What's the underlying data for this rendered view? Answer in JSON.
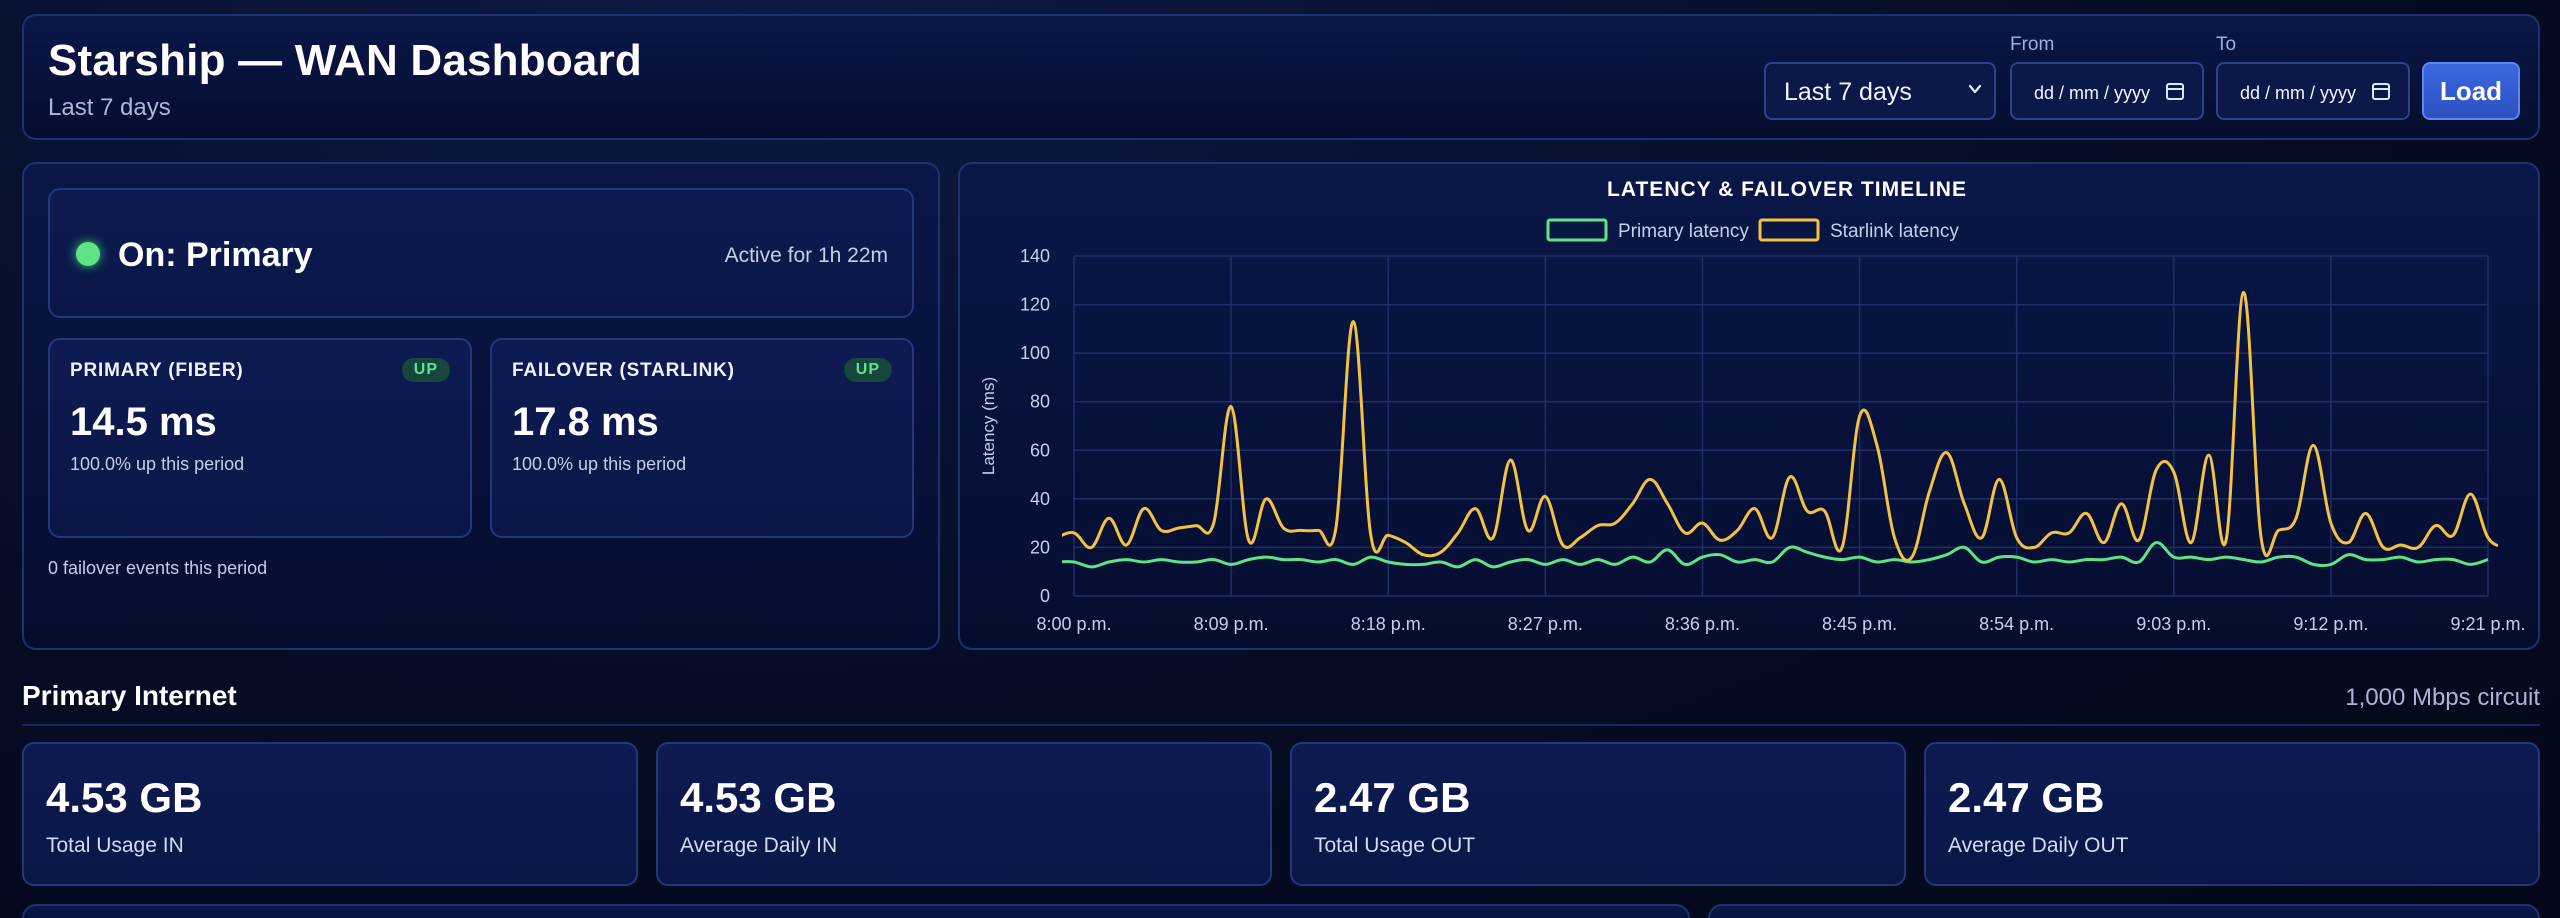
{
  "header": {
    "title": "Starship — WAN Dashboard",
    "subtitle": "Last 7 days",
    "range_selected": "Last 7 days",
    "from_label": "From",
    "to_label": "To",
    "from_value": "dd / mm / yyyy",
    "to_value": "dd / mm / yyyy",
    "load_label": "Load"
  },
  "status": {
    "state": "On: Primary",
    "active_for": "Active for 1h 22m",
    "color_ok": "#5ee487"
  },
  "links": {
    "primary": {
      "title": "PRIMARY (FIBER)",
      "badge": "UP",
      "latency": "14.5 ms",
      "uptime": "100.0% up this period"
    },
    "starlink": {
      "title": "FAILOVER (STARLINK)",
      "badge": "UP",
      "latency": "17.8 ms",
      "uptime": "100.0% up this period"
    }
  },
  "failover_events": "0 failover events this period",
  "primary_internet": {
    "title": "Primary Internet",
    "circuit": "1,000 Mbps circuit",
    "stats": [
      {
        "value": "4.53 GB",
        "label": "Total Usage IN"
      },
      {
        "value": "4.53 GB",
        "label": "Average Daily IN"
      },
      {
        "value": "2.47 GB",
        "label": "Total Usage OUT"
      },
      {
        "value": "2.47 GB",
        "label": "Average Daily OUT"
      }
    ]
  },
  "chart_data": {
    "type": "line",
    "title": "LATENCY & FAILOVER TIMELINE",
    "ylabel": "Latency (ms)",
    "xlabel": "",
    "ylim": [
      0,
      140
    ],
    "yticks": [
      0,
      20,
      40,
      60,
      80,
      100,
      120,
      140
    ],
    "xlim": [
      0,
      81
    ],
    "x_ticks": [
      {
        "x": 0,
        "label": "8:00 p.m."
      },
      {
        "x": 9,
        "label": "8:09 p.m."
      },
      {
        "x": 18,
        "label": "8:18 p.m."
      },
      {
        "x": 27,
        "label": "8:27 p.m."
      },
      {
        "x": 36,
        "label": "8:36 p.m."
      },
      {
        "x": 45,
        "label": "8:45 p.m."
      },
      {
        "x": 54,
        "label": "8:54 p.m."
      },
      {
        "x": 63,
        "label": "9:03 p.m."
      },
      {
        "x": 72,
        "label": "9:12 p.m."
      },
      {
        "x": 81,
        "label": "9:21 p.m."
      }
    ],
    "grid": true,
    "legend": "top-center",
    "series": [
      {
        "name": "Primary latency",
        "color": "#5ee487",
        "points": [
          [
            -1,
            14
          ],
          [
            0,
            14
          ],
          [
            1,
            12
          ],
          [
            2,
            14
          ],
          [
            3,
            15
          ],
          [
            4,
            14
          ],
          [
            5,
            15
          ],
          [
            6,
            14
          ],
          [
            7,
            14
          ],
          [
            8,
            15
          ],
          [
            9,
            13
          ],
          [
            10,
            15
          ],
          [
            11,
            16
          ],
          [
            12,
            15
          ],
          [
            13,
            15
          ],
          [
            14,
            14
          ],
          [
            15,
            15
          ],
          [
            16,
            13
          ],
          [
            17,
            16
          ],
          [
            18,
            14
          ],
          [
            19,
            13
          ],
          [
            20,
            13
          ],
          [
            21,
            14
          ],
          [
            22,
            12
          ],
          [
            23,
            15
          ],
          [
            24,
            12
          ],
          [
            25,
            14
          ],
          [
            26,
            15
          ],
          [
            27,
            13
          ],
          [
            28,
            15
          ],
          [
            29,
            13
          ],
          [
            30,
            15
          ],
          [
            31,
            13
          ],
          [
            32,
            16
          ],
          [
            33,
            14
          ],
          [
            34,
            19
          ],
          [
            35,
            13
          ],
          [
            36,
            16
          ],
          [
            37,
            17
          ],
          [
            38,
            14
          ],
          [
            39,
            15
          ],
          [
            40,
            14
          ],
          [
            41,
            20
          ],
          [
            42,
            18
          ],
          [
            43,
            16
          ],
          [
            44,
            15
          ],
          [
            45,
            16
          ],
          [
            46,
            14
          ],
          [
            47,
            15
          ],
          [
            48,
            14
          ],
          [
            49,
            15
          ],
          [
            50,
            17
          ],
          [
            51,
            20
          ],
          [
            52,
            14
          ],
          [
            53,
            16
          ],
          [
            54,
            16
          ],
          [
            55,
            14
          ],
          [
            56,
            15
          ],
          [
            57,
            14
          ],
          [
            58,
            15
          ],
          [
            59,
            15
          ],
          [
            60,
            16
          ],
          [
            61,
            14
          ],
          [
            62,
            22
          ],
          [
            63,
            16
          ],
          [
            64,
            16
          ],
          [
            65,
            15
          ],
          [
            66,
            16
          ],
          [
            67,
            15
          ],
          [
            68,
            14
          ],
          [
            69,
            16
          ],
          [
            70,
            16
          ],
          [
            71,
            13
          ],
          [
            72,
            13
          ],
          [
            73,
            17
          ],
          [
            74,
            15
          ],
          [
            75,
            15
          ],
          [
            76,
            16
          ],
          [
            77,
            14
          ],
          [
            78,
            15
          ],
          [
            79,
            15
          ],
          [
            80,
            13
          ],
          [
            81,
            15
          ]
        ]
      },
      {
        "name": "Starlink latency",
        "color": "#f4c242",
        "points": [
          [
            -1,
            24
          ],
          [
            0,
            26
          ],
          [
            1,
            20
          ],
          [
            2,
            32
          ],
          [
            3,
            21
          ],
          [
            4,
            36
          ],
          [
            5,
            27
          ],
          [
            6,
            28
          ],
          [
            7,
            29
          ],
          [
            8,
            30
          ],
          [
            9,
            78
          ],
          [
            10,
            23
          ],
          [
            11,
            40
          ],
          [
            12,
            28
          ],
          [
            13,
            27
          ],
          [
            14,
            27
          ],
          [
            15,
            28
          ],
          [
            16,
            113
          ],
          [
            17,
            25
          ],
          [
            18,
            25
          ],
          [
            19,
            22
          ],
          [
            20,
            17
          ],
          [
            21,
            18
          ],
          [
            22,
            26
          ],
          [
            23,
            36
          ],
          [
            24,
            24
          ],
          [
            25,
            56
          ],
          [
            26,
            27
          ],
          [
            27,
            41
          ],
          [
            28,
            21
          ],
          [
            29,
            24
          ],
          [
            30,
            29
          ],
          [
            31,
            30
          ],
          [
            32,
            38
          ],
          [
            33,
            48
          ],
          [
            34,
            38
          ],
          [
            35,
            26
          ],
          [
            36,
            30
          ],
          [
            37,
            23
          ],
          [
            38,
            27
          ],
          [
            39,
            36
          ],
          [
            40,
            24
          ],
          [
            41,
            49
          ],
          [
            42,
            35
          ],
          [
            43,
            35
          ],
          [
            44,
            20
          ],
          [
            45,
            74
          ],
          [
            46,
            62
          ],
          [
            47,
            24
          ],
          [
            48,
            16
          ],
          [
            49,
            43
          ],
          [
            50,
            59
          ],
          [
            51,
            38
          ],
          [
            52,
            24
          ],
          [
            53,
            48
          ],
          [
            54,
            24
          ],
          [
            55,
            20
          ],
          [
            56,
            26
          ],
          [
            57,
            26
          ],
          [
            58,
            34
          ],
          [
            59,
            22
          ],
          [
            60,
            38
          ],
          [
            61,
            23
          ],
          [
            62,
            52
          ],
          [
            63,
            51
          ],
          [
            64,
            22
          ],
          [
            65,
            58
          ],
          [
            66,
            23
          ],
          [
            67,
            125
          ],
          [
            68,
            24
          ],
          [
            69,
            27
          ],
          [
            70,
            32
          ],
          [
            71,
            62
          ],
          [
            72,
            30
          ],
          [
            73,
            22
          ],
          [
            74,
            34
          ],
          [
            75,
            20
          ],
          [
            76,
            21
          ],
          [
            77,
            20
          ],
          [
            78,
            29
          ],
          [
            79,
            25
          ],
          [
            80,
            42
          ],
          [
            81,
            24
          ],
          [
            82,
            20
          ],
          [
            83,
            18
          ]
        ]
      }
    ]
  }
}
